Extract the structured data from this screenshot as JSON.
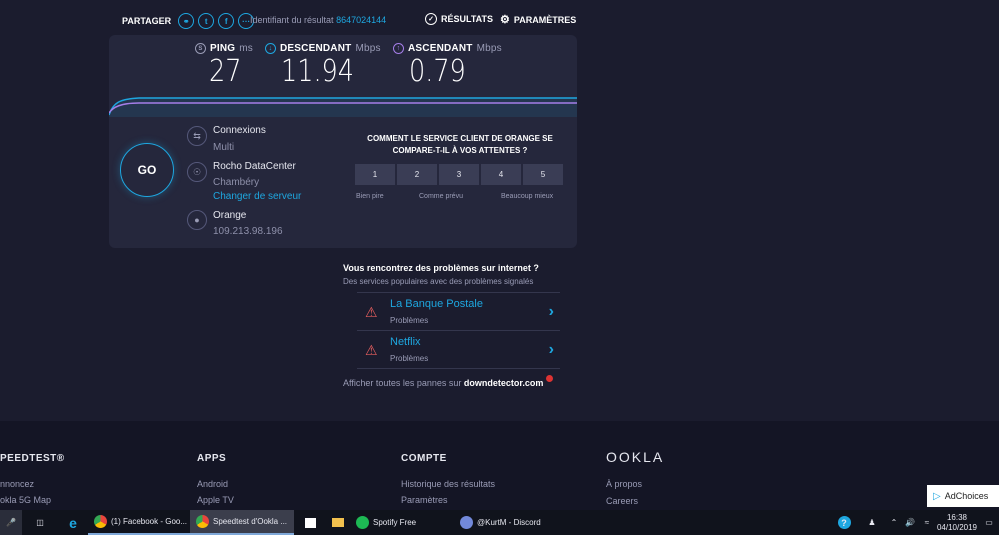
{
  "share": {
    "label": "PARTAGER",
    "icons": [
      "link-icon",
      "twitter-icon",
      "facebook-icon",
      "more-icon"
    ]
  },
  "result": {
    "label": "Identifiant du résultat",
    "id": "8647024144"
  },
  "top_buttons": {
    "results": "RÉSULTATS",
    "settings": "PARAMÈTRES"
  },
  "metrics": {
    "ping": {
      "label": "PING",
      "unit": "ms",
      "value": "27"
    },
    "download": {
      "label": "DESCENDANT",
      "unit": "Mbps",
      "value": "11.94"
    },
    "upload": {
      "label": "ASCENDANT",
      "unit": "Mbps",
      "value": "0.79"
    }
  },
  "go_label": "GO",
  "connection": {
    "connections_label": "Connexions",
    "connections_value": "Multi",
    "server_name": "Rocho DataCenter",
    "server_city": "Chambéry",
    "change_server": "Changer de serveur",
    "isp_name": "Orange",
    "isp_ip": "109.213.98.196"
  },
  "survey": {
    "question": "COMMENT LE SERVICE CLIENT DE ORANGE SE COMPARE-T-IL À VOS ATTENTES ?",
    "options": [
      "1",
      "2",
      "3",
      "4",
      "5"
    ],
    "low_label": "Bien pire",
    "mid_label": "Comme prévu",
    "high_label": "Beaucoup mieux"
  },
  "issues": {
    "heading": "Vous rencontrez des problèmes sur internet ?",
    "subheading": "Des services populaires avec des problèmes signalés",
    "items": [
      {
        "name": "La Banque Postale",
        "status": "Problèmes"
      },
      {
        "name": "Netflix",
        "status": "Problèmes"
      }
    ],
    "footer_text": "Afficher toutes les pannes sur",
    "footer_link": "downdetector.com"
  },
  "footer": {
    "col1": {
      "title": "PEEDTEST®",
      "items": [
        "nnoncez",
        "okla 5G Map"
      ]
    },
    "col2": {
      "title": "APPS",
      "items": [
        "Android",
        "Apple TV"
      ]
    },
    "col3": {
      "title": "COMPTE",
      "items": [
        "Historique des résultats",
        "Paramètres"
      ]
    },
    "col4": {
      "title": "OOKLA",
      "items": [
        "À propos",
        "Careers"
      ]
    }
  },
  "adchoices": "AdChoices",
  "taskbar": {
    "items": [
      {
        "label": "(1) Facebook - Goo...",
        "color": "#e8453c"
      },
      {
        "label": "Speedtest d'Ookla ...",
        "color": "#e8453c"
      },
      {
        "label": "Spotify Free",
        "color": "#1db954"
      },
      {
        "label": "@KurtM - Discord",
        "color": "#7289da"
      }
    ],
    "time": "16:38",
    "date": "04/10/2019"
  },
  "colors": {
    "accent": "#1ea7e0",
    "upload": "#a57ee8",
    "warning": "#e85f5f",
    "background": "#1b1c2e",
    "card": "#25273c"
  }
}
